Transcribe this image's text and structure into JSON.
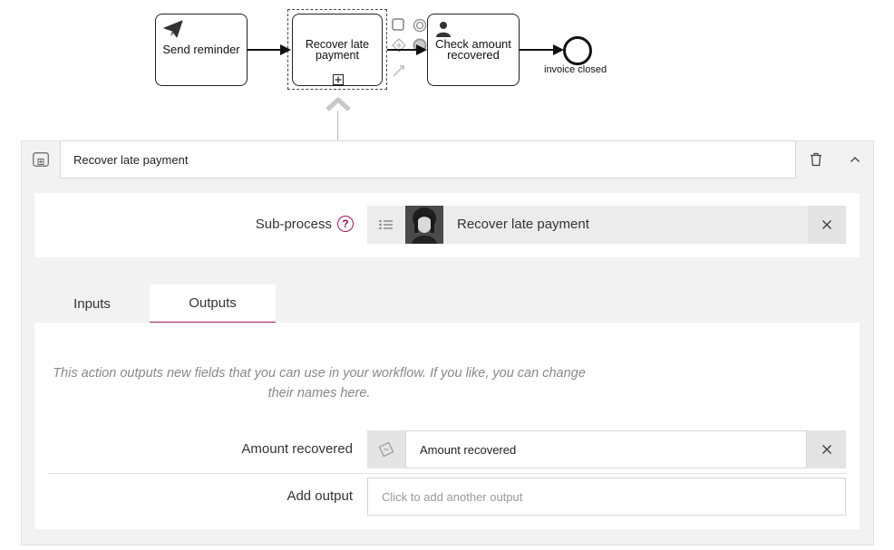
{
  "diagram": {
    "task_send_reminder": "Send reminder",
    "task_recover": "Recover late\npayment",
    "task_check_amount": "Check amount\nrecovered",
    "end_event_label": "invoice closed"
  },
  "panel": {
    "title_value": "Recover late payment",
    "subprocess": {
      "label": "Sub-process",
      "help": "?",
      "selected": "Recover late payment"
    },
    "tabs": [
      {
        "label": "Inputs",
        "active": false
      },
      {
        "label": "Outputs",
        "active": true
      }
    ],
    "outputs": {
      "info": "This action outputs new fields that you can use in your workflow. If you like, you can change their names here.",
      "fields": [
        {
          "label": "Amount recovered",
          "value": "Amount recovered"
        }
      ],
      "add_label": "Add output",
      "add_placeholder": "Click to add another output"
    }
  },
  "colors": {
    "accent": "#a0135e",
    "panel_bg": "#f2f2f2",
    "picker_bg": "#ececec"
  },
  "icons": {
    "send_task": "paper-plane-icon",
    "user_task": "user-icon",
    "subprocess_marker": "plus-square-icon",
    "panel_type": "subprocess-icon",
    "delete": "trash-icon",
    "collapse": "chevron-up-icon",
    "list": "list-icon",
    "field_type": "tag-icon",
    "remove": "close-icon"
  }
}
